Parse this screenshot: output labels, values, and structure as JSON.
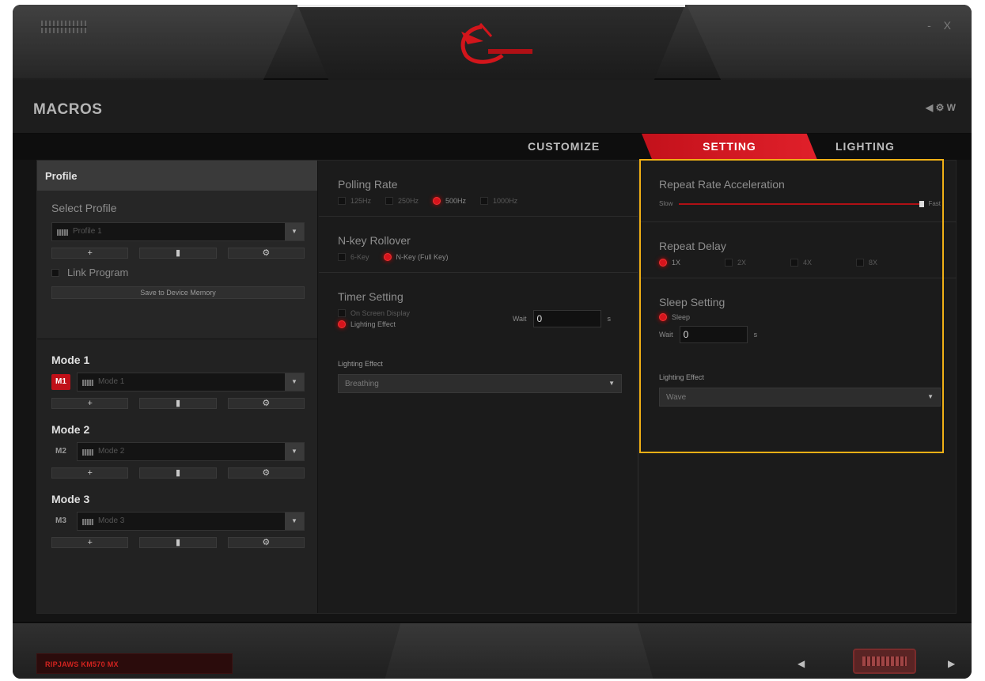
{
  "header": {
    "window_controls": "- X"
  },
  "title": {
    "text": "MACROS",
    "icons": "◀ ⚙ W"
  },
  "tabs": [
    {
      "label": "CUSTOMIZE"
    },
    {
      "label": "SETTING"
    },
    {
      "label": "LIGHTING"
    }
  ],
  "profile": {
    "header": "Profile",
    "select_label": "Select Profile",
    "selected": "Profile 1",
    "buttons": [
      "+",
      "▮",
      "⚙"
    ],
    "link_program": "Link Program",
    "save_button": "Save to Device Memory"
  },
  "modes": [
    {
      "title": "Mode 1",
      "badge": "M1",
      "selected": "Mode 1",
      "active": true
    },
    {
      "title": "Mode 2",
      "badge": "M2",
      "selected": "Mode 2",
      "active": false
    },
    {
      "title": "Mode 3",
      "badge": "M3",
      "selected": "Mode 3",
      "active": false
    }
  ],
  "polling_rate": {
    "title": "Polling Rate",
    "options": [
      "125Hz",
      "250Hz",
      "500Hz",
      "1000Hz"
    ],
    "selected": "500Hz"
  },
  "nkey": {
    "title": "N-key Rollover",
    "options": [
      "6-Key",
      "N-Key (Full Key)"
    ],
    "selected": "N-Key (Full Key)"
  },
  "timer": {
    "title": "Timer Setting",
    "options": [
      "On Screen Display",
      "Lighting Effect"
    ],
    "selected": "Lighting Effect",
    "wait_label": "Wait",
    "wait_value": "0",
    "unit": "s",
    "effect_label": "Lighting Effect",
    "effect_value": "Breathing"
  },
  "repeat_rate": {
    "title": "Repeat Rate Acceleration",
    "min_label": "Slow",
    "max_label": "Fast"
  },
  "repeat_delay": {
    "title": "Repeat Delay",
    "options": [
      "1X",
      "2X",
      "4X",
      "8X"
    ],
    "selected": "1X"
  },
  "sleep": {
    "title": "Sleep Setting",
    "option": "Sleep",
    "wait_label": "Wait",
    "wait_value": "0",
    "unit": "s",
    "effect_label": "Lighting Effect",
    "effect_value": "Wave"
  },
  "footer": {
    "device": "RIPJAWS KM570 MX"
  },
  "colors": {
    "accent": "#d7141c",
    "highlight": "#f0b016"
  }
}
